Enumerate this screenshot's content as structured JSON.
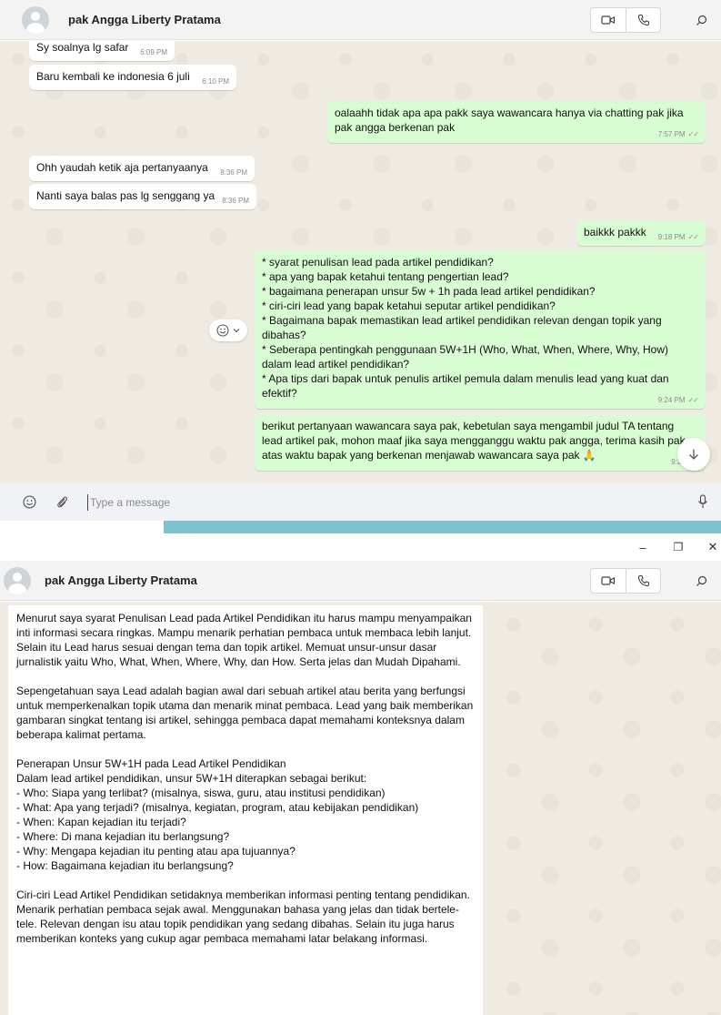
{
  "contact": {
    "name": "pak Angga Liberty Pratama"
  },
  "icons": {
    "avatar": "default-avatar-icon",
    "video": "video-call-icon",
    "call": "phone-icon",
    "search": "search-icon",
    "emoji": "emoji-icon",
    "attach": "paperclip-icon",
    "mic": "microphone-icon",
    "scroll": "arrow-down-icon",
    "minimize": "minimize-icon",
    "restore": "restore-icon",
    "close": "close-icon"
  },
  "colors": {
    "outgoing": "#d9fdd3",
    "incoming": "#ffffff",
    "chat_bg": "#efeae2",
    "header": "#f3f3f3",
    "desktop": "#7fc3cf"
  },
  "messages": [
    {
      "dir": "in",
      "text": "Sy soalnya lg safar",
      "time": "6:09 PM"
    },
    {
      "dir": "in",
      "text": "Baru kembali ke indonesia 6 juli",
      "time": "6:10 PM"
    },
    {
      "dir": "out",
      "text": "oalaahh tidak apa apa pakk saya wawancara hanya via chatting pak jika pak angga berkenan pak",
      "time": "7:57 PM"
    },
    {
      "dir": "in",
      "text": "Ohh yaudah ketik aja pertanyaanya",
      "time": "8:36 PM"
    },
    {
      "dir": "in",
      "text": "Nanti saya balas pas lg senggang ya",
      "time": "8:36 PM"
    },
    {
      "dir": "out",
      "text": "baikkk pakkk",
      "time": "9:18 PM"
    },
    {
      "dir": "out",
      "text": "* syarat penulisan lead pada artikel pendidikan?\n* apa yang bapak ketahui tentang pengertian lead?\n* bagaimana penerapan unsur 5w + 1h pada lead artikel pendidikan?\n* ciri-ciri lead yang bapak ketahui seputar artikel pendidikan?\n* Bagaimana bapak memastikan lead artikel pendidikan relevan dengan topik yang dibahas?\n* Seberapa pentingkah penggunaan 5W+1H (Who, What, When, Where, Why, How) dalam lead artikel pendidikan?\n* Apa tips dari bapak untuk penulis artikel pemula dalam menulis lead yang kuat dan efektif?",
      "time": "9:24 PM"
    },
    {
      "dir": "out",
      "text": "berikut pertanyaan wawancara saya pak, kebetulan saya mengambil judul TA tentang lead artikel pak, mohon maaf jika saya mengganggu waktu pak angga, terima kasih pak atas waktu bapak yang berkenan menjawab wawancara saya pak 🙏",
      "time": "9:25 PM"
    }
  ],
  "composer": {
    "placeholder": "Type a message"
  },
  "window_controls": {
    "minimize": "–",
    "restore": "❐",
    "close": "✕"
  },
  "reply": {
    "paragraphs": [
      "Menurut saya syarat Penulisan Lead pada Artikel Pendidikan itu harus mampu menyampaikan inti informasi secara ringkas. Mampu menarik perhatian pembaca untuk membaca lebih lanjut. Selain itu Lead harus sesuai dengan tema dan topik artikel. Memuat unsur-unsur dasar jurnalistik yaitu Who, What, When, Where, Why, dan How. Serta jelas dan Mudah Dipahami.",
      "Sepengetahuan saya Lead adalah bagian awal dari sebuah artikel atau berita yang berfungsi untuk memperkenalkan topik utama dan menarik minat pembaca. Lead yang baik memberikan gambaran singkat tentang isi artikel, sehingga pembaca dapat memahami konteksnya dalam beberapa kalimat pertama.",
      "Penerapan Unsur 5W+1H pada Lead Artikel Pendidikan\nDalam lead artikel pendidikan, unsur 5W+1H diterapkan sebagai berikut:\n- Who: Siapa yang terlibat? (misalnya, siswa, guru, atau institusi pendidikan)\n- What: Apa yang terjadi? (misalnya, kegiatan, program, atau kebijakan pendidikan)\n- When: Kapan kejadian itu terjadi?\n- Where: Di mana kejadian itu berlangsung?\n- Why: Mengapa kejadian itu penting atau apa tujuannya?\n- How: Bagaimana kejadian itu berlangsung?",
      "Ciri-ciri Lead Artikel Pendidikan setidaknya memberikan informasi penting tentang pendidikan. Menarik perhatian pembaca sejak awal. Menggunakan bahasa yang jelas dan tidak bertele-tele. Relevan dengan isu atau topik pendidikan yang sedang dibahas. Selain itu juga harus memberikan konteks yang cukup agar pembaca memahami latar belakang informasi."
    ]
  }
}
